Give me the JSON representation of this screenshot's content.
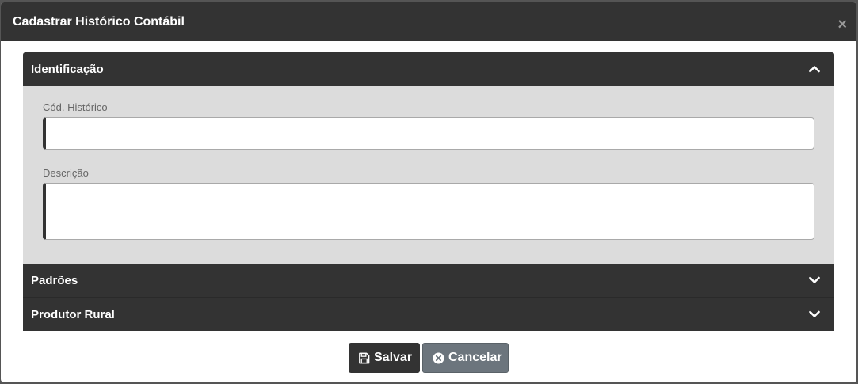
{
  "modal": {
    "title": "Cadastrar Histórico Contábil",
    "close_label": "×"
  },
  "sections": {
    "identificacao": {
      "label": "Identificação",
      "expanded": true,
      "fields": {
        "cod_historico": {
          "label": "Cód. Histórico",
          "value": ""
        },
        "descricao": {
          "label": "Descrição",
          "value": ""
        }
      }
    },
    "padroes": {
      "label": "Padrões",
      "expanded": false
    },
    "produtor_rural": {
      "label": "Produtor Rural",
      "expanded": false
    }
  },
  "footer": {
    "save_label": "Salvar",
    "cancel_label": "Cancelar"
  },
  "colors": {
    "header_bg": "#333333",
    "body_bg": "#dcdcdc",
    "cancel_bg": "#6c757d"
  },
  "icons": {
    "collapse": "chevron-up-icon",
    "expand": "chevron-down-icon",
    "save": "floppy-disk-icon",
    "cancel": "x-circle-icon"
  }
}
